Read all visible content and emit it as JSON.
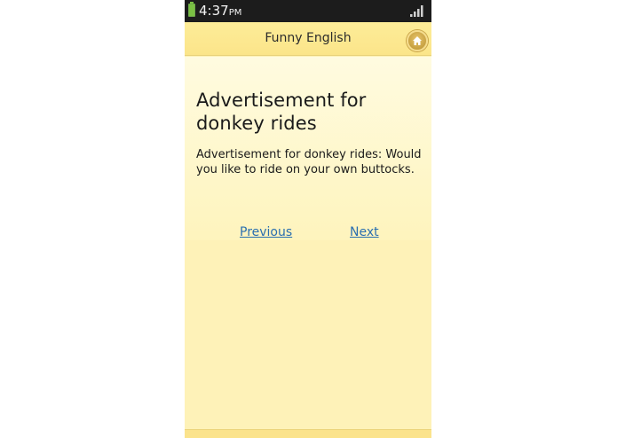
{
  "status_bar": {
    "time": "4:37",
    "ampm": "PM",
    "battery_icon": "battery-icon",
    "signal_icon": "signal-icon"
  },
  "header": {
    "title": "Funny English",
    "home_icon": "home-icon"
  },
  "article": {
    "title": "Advertisement for donkey rides",
    "body": "Advertisement for donkey rides: Would you like to ride on your own buttocks."
  },
  "navigation": {
    "previous_label": "Previous",
    "next_label": "Next"
  },
  "colors": {
    "background": "#fef2b8",
    "header": "#fbe58a",
    "link": "#2a6fb0",
    "status_bar": "#1c1c1c"
  }
}
